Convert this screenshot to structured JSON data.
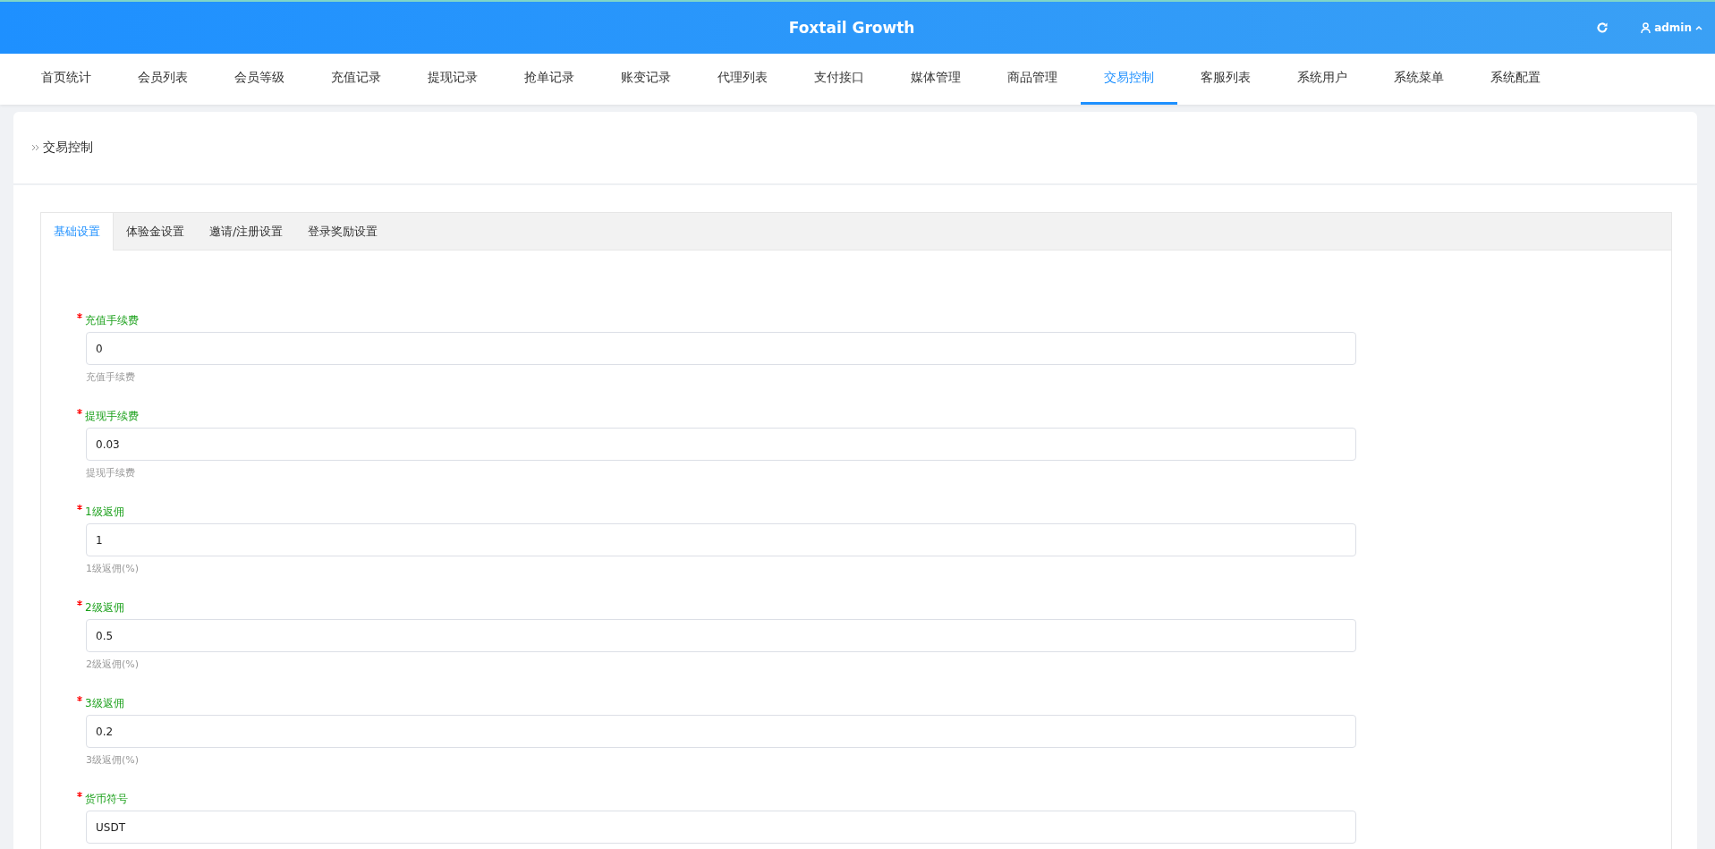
{
  "header": {
    "title": "Foxtail Growth",
    "user": "admin"
  },
  "nav": [
    {
      "label": "首页统计",
      "selected": false
    },
    {
      "label": "会员列表",
      "selected": false
    },
    {
      "label": "会员等级",
      "selected": false
    },
    {
      "label": "充值记录",
      "selected": false
    },
    {
      "label": "提现记录",
      "selected": false
    },
    {
      "label": "抢单记录",
      "selected": false
    },
    {
      "label": "账变记录",
      "selected": false
    },
    {
      "label": "代理列表",
      "selected": false
    },
    {
      "label": "支付接口",
      "selected": false
    },
    {
      "label": "媒体管理",
      "selected": false
    },
    {
      "label": "商品管理",
      "selected": false
    },
    {
      "label": "交易控制",
      "selected": true
    },
    {
      "label": "客服列表",
      "selected": false
    },
    {
      "label": "系统用户",
      "selected": false
    },
    {
      "label": "系统菜单",
      "selected": false
    },
    {
      "label": "系统配置",
      "selected": false
    }
  ],
  "breadcrumb": "交易控制",
  "tabs": [
    {
      "label": "基础设置",
      "selected": true
    },
    {
      "label": "体验金设置",
      "selected": false
    },
    {
      "label": "邀请/注册设置",
      "selected": false
    },
    {
      "label": "登录奖励设置",
      "selected": false
    }
  ],
  "fields": [
    {
      "label": "充值手续费",
      "required": true,
      "value": "0",
      "help": "充值手续费"
    },
    {
      "label": "提现手续费",
      "required": true,
      "value": "0.03",
      "help": "提现手续费"
    },
    {
      "label": "1级返佣",
      "required": true,
      "value": "1",
      "help": "1级返佣(%)"
    },
    {
      "label": "2级返佣",
      "required": true,
      "value": "0.5",
      "help": "2级返佣(%)"
    },
    {
      "label": "3级返佣",
      "required": true,
      "value": "0.2",
      "help": "3级返佣(%)"
    },
    {
      "label": "货币符号",
      "required": true,
      "value": "USDT"
    }
  ]
}
